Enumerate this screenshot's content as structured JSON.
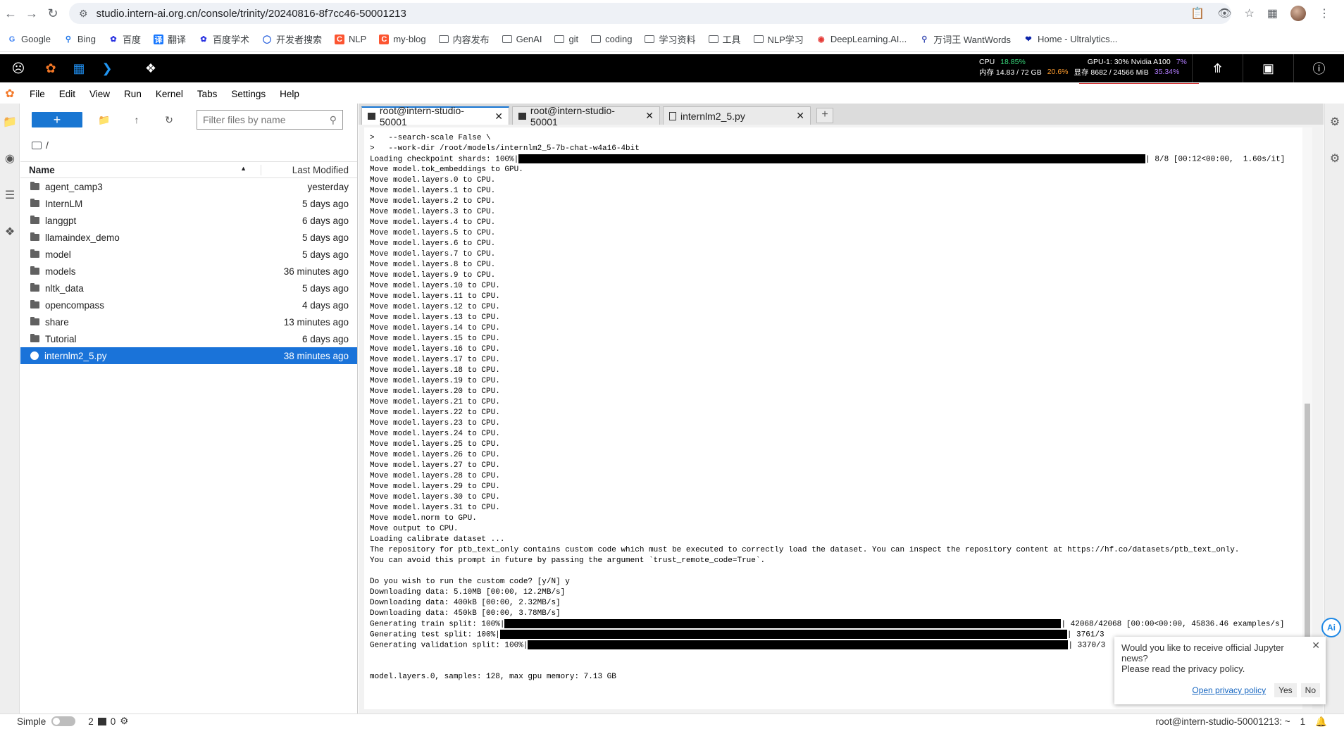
{
  "browser": {
    "url": "studio.intern-ai.org.cn/console/trinity/20240816-8f7cc46-50001213",
    "bookmarks": [
      {
        "label": "Google",
        "icon": "google-icon"
      },
      {
        "label": "Bing",
        "icon": "search-icon"
      },
      {
        "label": "百度",
        "icon": "baidu-icon"
      },
      {
        "label": "翻译",
        "icon": "translate-icon"
      },
      {
        "label": "百度学术",
        "icon": "baidu-icon"
      },
      {
        "label": "开发者搜索",
        "icon": "dev-search-icon"
      },
      {
        "label": "NLP",
        "icon": "c-icon"
      },
      {
        "label": "my-blog",
        "icon": "c-icon"
      },
      {
        "label": "内容发布",
        "icon": "folder-icon"
      },
      {
        "label": "GenAI",
        "icon": "folder-icon"
      },
      {
        "label": "git",
        "icon": "folder-icon"
      },
      {
        "label": "coding",
        "icon": "folder-icon"
      },
      {
        "label": "学习资料",
        "icon": "folder-icon"
      },
      {
        "label": "工具",
        "icon": "folder-icon"
      },
      {
        "label": "NLP学习",
        "icon": "folder-icon"
      },
      {
        "label": "DeepLearning.AI...",
        "icon": "deeplearning-icon"
      },
      {
        "label": "万词王 WantWords",
        "icon": "wantwords-icon"
      },
      {
        "label": "Home - Ultralytics...",
        "icon": "ultralytics-icon"
      }
    ]
  },
  "monitor": {
    "cpu_label": "CPU",
    "cpu_value": "18.85%",
    "mem_label": "内存 14.83 / 72 GB",
    "mem_value": "20.6%",
    "gpu_label": "GPU-1: 30% Nvidia A100",
    "gpu_value": "7%",
    "vram_label": "显存 8682 / 24566 MiB",
    "vram_value": "35.34%"
  },
  "menu": [
    "File",
    "Edit",
    "View",
    "Run",
    "Kernel",
    "Tabs",
    "Settings",
    "Help"
  ],
  "file_browser": {
    "filter_placeholder": "Filter files by name",
    "breadcrumb": "/",
    "col_name": "Name",
    "col_modified": "Last Modified",
    "files": [
      {
        "name": "agent_camp3",
        "modified": "yesterday",
        "type": "folder"
      },
      {
        "name": "InternLM",
        "modified": "5 days ago",
        "type": "folder"
      },
      {
        "name": "langgpt",
        "modified": "6 days ago",
        "type": "folder"
      },
      {
        "name": "llamaindex_demo",
        "modified": "5 days ago",
        "type": "folder"
      },
      {
        "name": "model",
        "modified": "5 days ago",
        "type": "folder"
      },
      {
        "name": "models",
        "modified": "36 minutes ago",
        "type": "folder"
      },
      {
        "name": "nltk_data",
        "modified": "5 days ago",
        "type": "folder"
      },
      {
        "name": "opencompass",
        "modified": "4 days ago",
        "type": "folder"
      },
      {
        "name": "share",
        "modified": "13 minutes ago",
        "type": "folder"
      },
      {
        "name": "Tutorial",
        "modified": "6 days ago",
        "type": "folder"
      },
      {
        "name": "internlm2_5.py",
        "modified": "38 minutes ago",
        "type": "python"
      }
    ]
  },
  "tabs": [
    {
      "label": "root@intern-studio-50001",
      "type": "terminal",
      "active": true
    },
    {
      "label": "root@intern-studio-50001",
      "type": "terminal",
      "active": false
    },
    {
      "label": "internlm2_5.py",
      "type": "file",
      "active": false
    }
  ],
  "terminal": {
    "lines_top": [
      ">   --search-scale False \\",
      ">   --work-dir /root/models/internlm2_5-7b-chat-w4a16-4bit"
    ],
    "checkpoint_prefix": "Loading checkpoint shards: 100%|",
    "checkpoint_suffix": "| 8/8 [00:12<00:00,  1.60s/it]",
    "lines_mid": [
      "Move model.tok_embeddings to GPU.",
      "Move model.layers.0 to CPU.",
      "Move model.layers.1 to CPU.",
      "Move model.layers.2 to CPU.",
      "Move model.layers.3 to CPU.",
      "Move model.layers.4 to CPU.",
      "Move model.layers.5 to CPU.",
      "Move model.layers.6 to CPU.",
      "Move model.layers.7 to CPU.",
      "Move model.layers.8 to CPU.",
      "Move model.layers.9 to CPU.",
      "Move model.layers.10 to CPU.",
      "Move model.layers.11 to CPU.",
      "Move model.layers.12 to CPU.",
      "Move model.layers.13 to CPU.",
      "Move model.layers.14 to CPU.",
      "Move model.layers.15 to CPU.",
      "Move model.layers.16 to CPU.",
      "Move model.layers.17 to CPU.",
      "Move model.layers.18 to CPU.",
      "Move model.layers.19 to CPU.",
      "Move model.layers.20 to CPU.",
      "Move model.layers.21 to CPU.",
      "Move model.layers.22 to CPU.",
      "Move model.layers.23 to CPU.",
      "Move model.layers.24 to CPU.",
      "Move model.layers.25 to CPU.",
      "Move model.layers.26 to CPU.",
      "Move model.layers.27 to CPU.",
      "Move model.layers.28 to CPU.",
      "Move model.layers.29 to CPU.",
      "Move model.layers.30 to CPU.",
      "Move model.layers.31 to CPU.",
      "Move model.norm to GPU.",
      "Move output to CPU.",
      "Loading calibrate dataset ...",
      "The repository for ptb_text_only contains custom code which must be executed to correctly load the dataset. You can inspect the repository content at https://hf.co/datasets/ptb_text_only.",
      "You can avoid this prompt in future by passing the argument `trust_remote_code=True`.",
      "",
      "Do you wish to run the custom code? [y/N] y",
      "Downloading data: 5.10MB [00:00, 12.2MB/s]",
      "Downloading data: 400kB [00:00, 2.32MB/s]",
      "Downloading data: 450kB [00:00, 3.78MB/s]"
    ],
    "train_prefix": "Generating train split: 100%|",
    "train_suffix": "| 42068/42068 [00:00<00:00, 45836.46 examples/s]",
    "test_prefix": "Generating test split: 100%|",
    "test_suffix": "| 3761/3",
    "val_prefix": "Generating validation split: 100%|",
    "val_suffix": "| 3370/3",
    "final_line": "model.layers.0, samples: 128, max gpu memory: 7.13 GB"
  },
  "notification": {
    "text1": "Would you like to receive official Jupyter news?",
    "text2": "Please read the privacy policy.",
    "link": "Open privacy policy",
    "yes": "Yes",
    "no": "No"
  },
  "ai_badge": "Ai",
  "statusbar": {
    "mode_label": "Simple",
    "terminals_count": "2",
    "kernels_count": "0",
    "right_text": "root@intern-studio-50001213: ~",
    "right_count": "1"
  }
}
